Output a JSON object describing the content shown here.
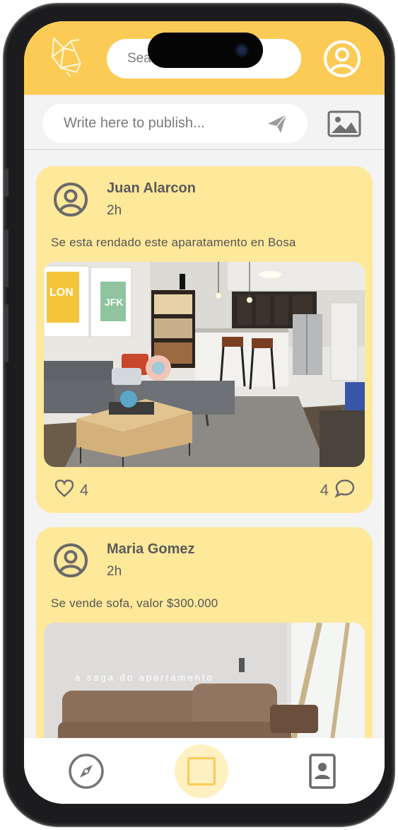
{
  "header": {
    "search_placeholder": "Search"
  },
  "composer": {
    "placeholder": "Write here to publish..."
  },
  "posts": [
    {
      "author": "Juan Alarcon",
      "time": "2h",
      "text": "Se esta rendado este aparatamento en Bosa",
      "likes": "4",
      "comments": "4",
      "image_tags": [
        "LON",
        "JFK"
      ]
    },
    {
      "author": "Maria Gomez",
      "time": "2h",
      "text": "Se vende sofa, valor $300.000",
      "image_caption": "a saga do apartamento"
    }
  ],
  "icons": {
    "logo": "origami-bird-icon",
    "profile": "user-circle-icon",
    "send": "paper-plane-icon",
    "image": "image-icon",
    "like": "heart-icon",
    "comment": "speech-bubble-icon",
    "explore": "compass-icon",
    "home": "square-icon",
    "contact": "contact-card-icon"
  },
  "colors": {
    "accent": "#fbcb55",
    "card": "#fee89a",
    "background": "#f3f3f3"
  }
}
